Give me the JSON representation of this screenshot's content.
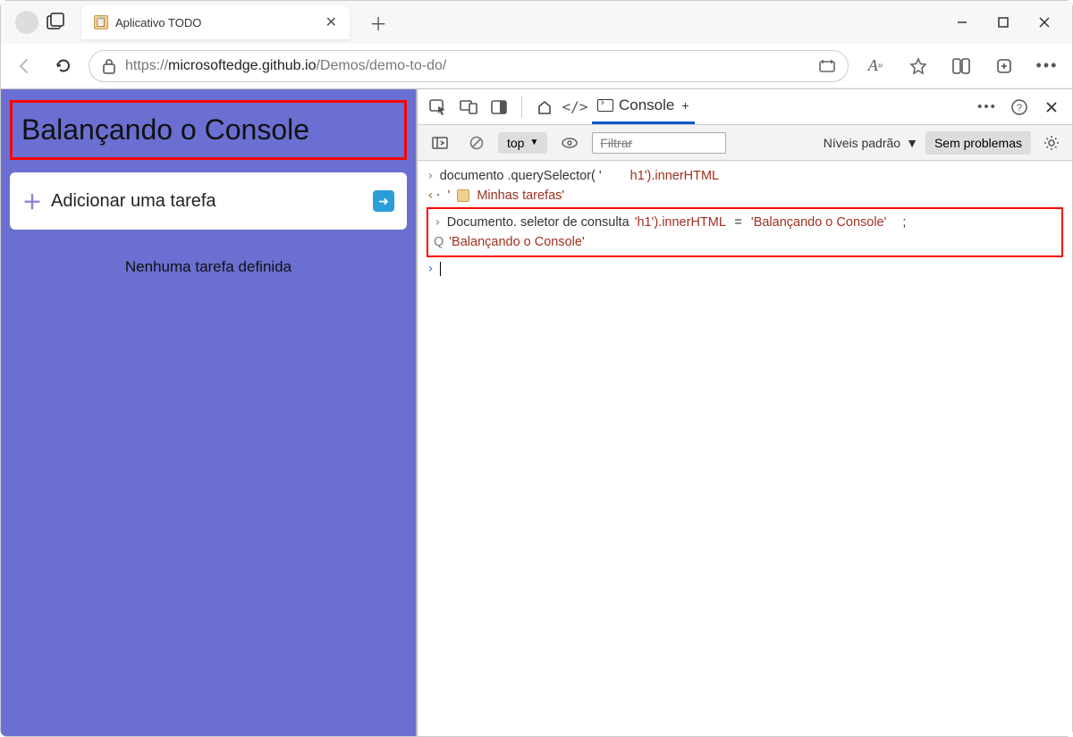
{
  "window": {
    "tab_title": "Aplicativo TODO",
    "url_prefix": "https://",
    "url_host": "microsoftedge.github.io",
    "url_path": "/Demos/demo-to-do/"
  },
  "app": {
    "heading": "Balançando o Console",
    "add_task_label": "Adicionar uma tarefa",
    "no_tasks": "Nenhuma tarefa definida"
  },
  "devtools": {
    "tabs": {
      "console": "Console"
    },
    "toolbar": {
      "context": "top",
      "filter_placeholder": "Filtrar",
      "levels": "Níveis padrão",
      "issues": "Sem problemas"
    },
    "console": {
      "line1_a": "documento .querySelector( '",
      "line1_b": "h1').innerHTML",
      "line2_prefix": "'",
      "line2_text": "Minhas tarefas'",
      "line3_a": "Documento. seletor de consulta",
      "line3_b": "'h1').innerHTML",
      "line3_c": "=",
      "line3_d": "'Balançando o    Console'",
      "line3_e": ";",
      "line4_prefix": "Q",
      "line4_text": "'Balançando o      Console'"
    }
  }
}
